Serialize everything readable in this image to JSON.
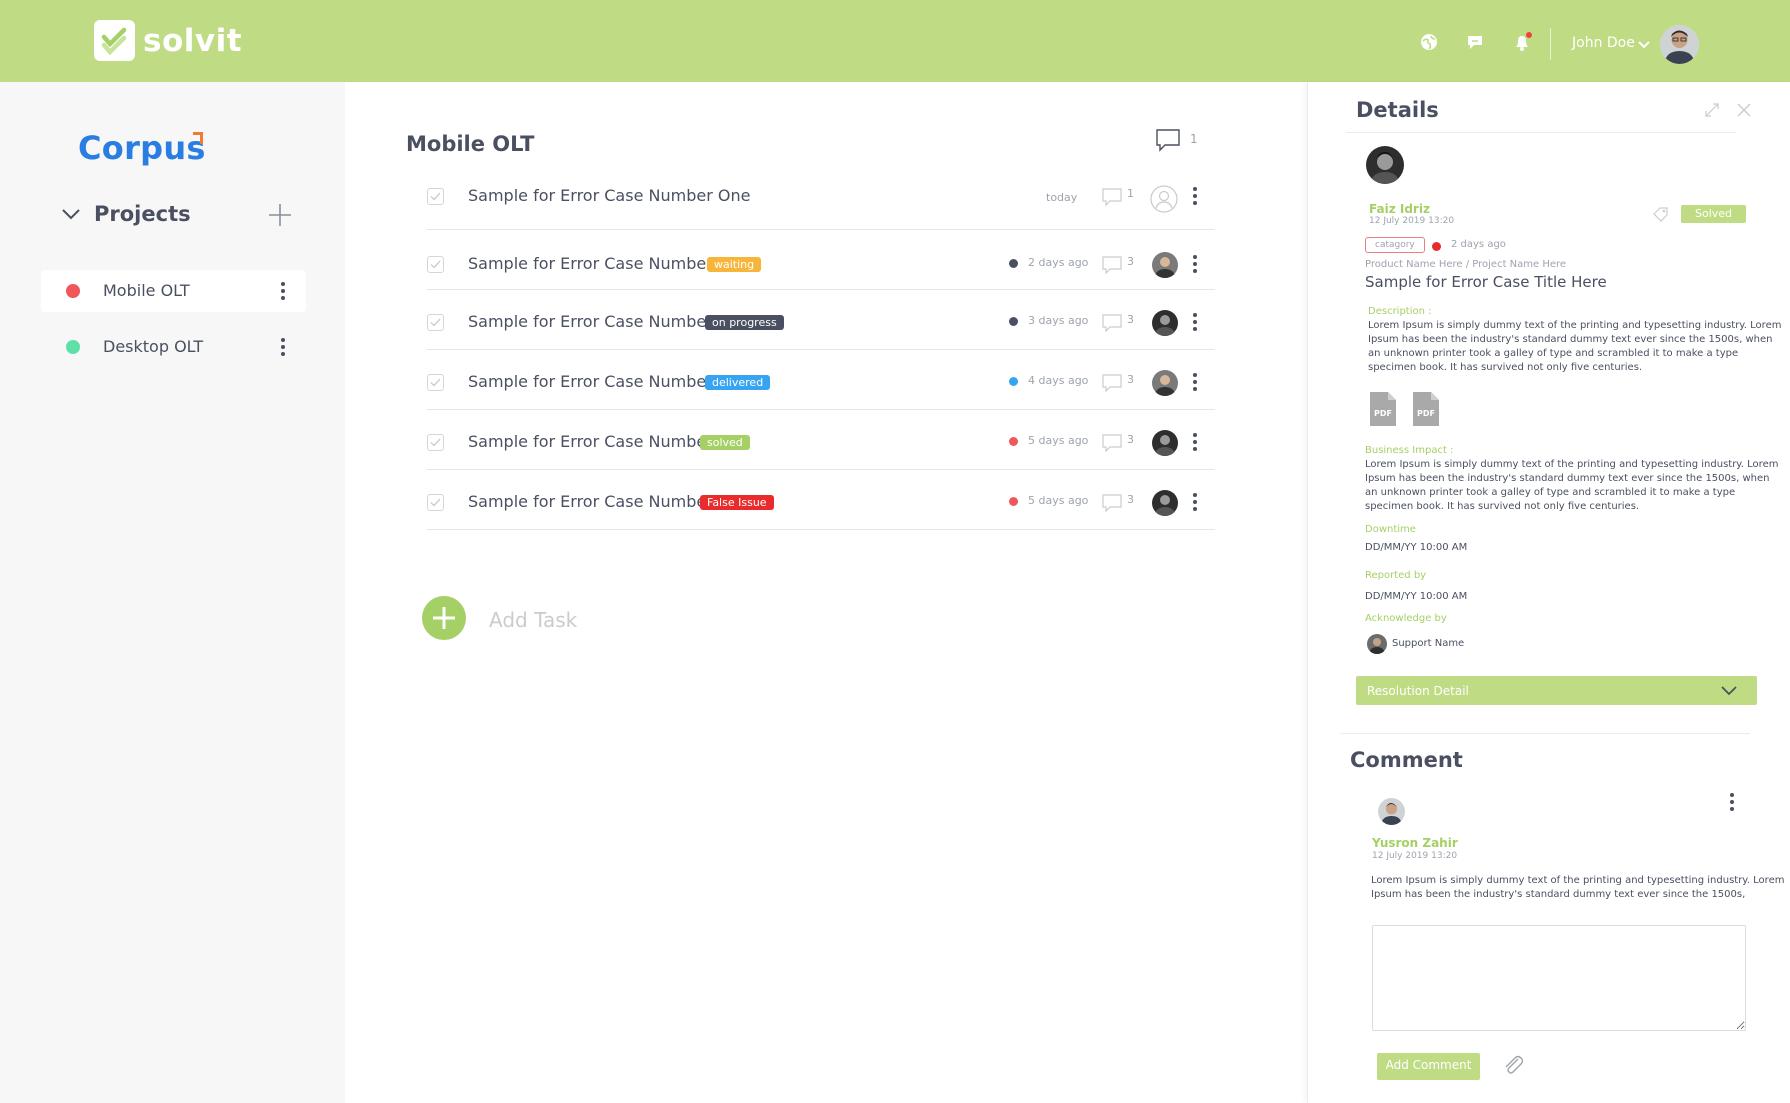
{
  "topbar": {
    "brand": "solvit",
    "user_name": "John Doe",
    "icons": [
      "globe-icon",
      "chat-icon",
      "bell-icon"
    ]
  },
  "sidebar": {
    "company": "Corpus",
    "projects_title": "Projects",
    "projects": [
      {
        "label": "Mobile OLT",
        "color": "#f0565a"
      },
      {
        "label": "Desktop OLT",
        "color": "#5fe0a6"
      }
    ]
  },
  "main": {
    "title": "Mobile OLT",
    "comment_count": "1",
    "tasks": [
      {
        "title": "Sample for Error Case Number One",
        "badge": "",
        "time": "today",
        "comments": "1",
        "dot": ""
      },
      {
        "title": "Sample for Error Case Number Two",
        "badge": "waiting",
        "badge_color": "#f7b53b",
        "time": "2 days ago",
        "comments": "3",
        "dot": "#4a5061"
      },
      {
        "title": "Sample for Error Case Number Three",
        "badge": "on progress",
        "badge_color": "#4a5061",
        "time": "3 days ago",
        "comments": "3",
        "dot": "#4a5061"
      },
      {
        "title": "Sample for Error Case Number Four",
        "badge": "delivered",
        "badge_color": "#36a4f0",
        "time": "4 days ago",
        "comments": "3",
        "dot": "#36a4f0"
      },
      {
        "title": "Sample for Error Case Number Five",
        "badge": "solved",
        "badge_color": "#a5d065",
        "time": "5 days ago",
        "comments": "3",
        "dot": "#f0565a"
      },
      {
        "title": "Sample for Error Case Number Five",
        "badge": "False Issue",
        "badge_color": "#ea2b2b",
        "time": "5 days ago",
        "comments": "3",
        "dot": "#f0565a"
      }
    ],
    "add_task": "Add Task"
  },
  "details": {
    "title": "Details",
    "reporter": "Faiz Idriz",
    "reported_at": "12 July 2019 13:20",
    "status": "Solved",
    "category": "catagory",
    "age": "2 days ago",
    "breadcrumb": "Product Name Here / Project Name Here",
    "case_title": "Sample for Error Case Title Here",
    "description_label": "Description :",
    "description": "Lorem Ipsum is simply dummy text of the printing and typesetting industry. Lorem Ipsum has been the industry's standard dummy text ever since the 1500s, when an unknown printer took a galley of type and scrambled it to make a type specimen book. It has survived not only five centuries.",
    "attachments": [
      "PDF",
      "PDF"
    ],
    "impact_label": "Business Impact :",
    "impact": "Lorem Ipsum is simply dummy text of the printing and typesetting industry. Lorem Ipsum has been the industry's standard dummy text ever since the 1500s, when an unknown printer took a galley of type and scrambled it to make a type specimen book. It has survived not only five centuries.",
    "downtime_label": "Downtime",
    "downtime": "DD/MM/YY 10:00 AM",
    "reported_by_label": "Reported by",
    "reported_by": "DD/MM/YY 10:00 AM",
    "ack_label": "Acknowledge by",
    "ack_name": "Support Name",
    "resolution_label": "Resolution Detail"
  },
  "comment": {
    "title": "Comment",
    "author": "Yusron Zahir",
    "date": "12 July 2019 13:20",
    "text": "Lorem Ipsum is simply dummy text of the printing and typesetting industry. Lorem Ipsum has been the industry's standard dummy text ever since the 1500s,",
    "button": "Add Comment"
  }
}
